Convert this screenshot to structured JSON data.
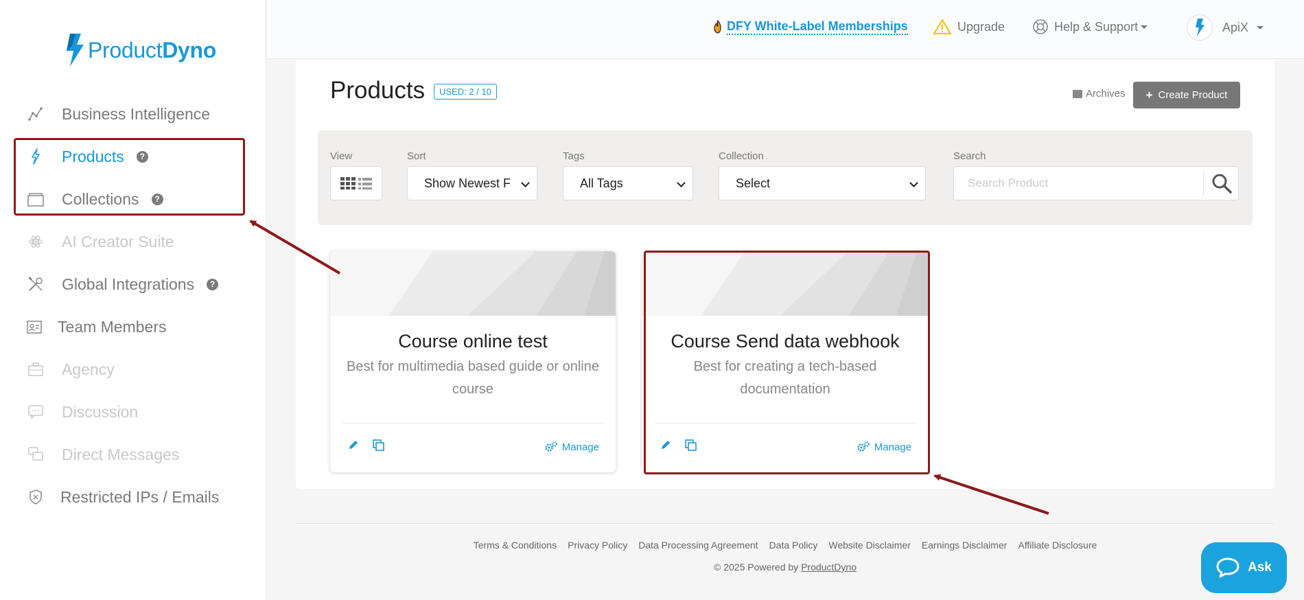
{
  "brand": {
    "name_light": "Product",
    "name_bold": "Dyno",
    "color": "#1a97d8"
  },
  "sidebar": {
    "items": [
      {
        "label": "Business Intelligence",
        "icon": "chart-line-icon"
      },
      {
        "label": "Products",
        "icon": "bolt-icon",
        "active": true
      },
      {
        "label": "Collections",
        "icon": "folder-icon"
      },
      {
        "label": "AI Creator Suite",
        "icon": "atom-icon",
        "disabled": true
      },
      {
        "label": "Global Integrations",
        "icon": "tools-icon"
      },
      {
        "label": "Team Members",
        "icon": "id-card-icon"
      },
      {
        "label": "Agency",
        "icon": "briefcase-icon",
        "disabled": true
      },
      {
        "label": "Discussion",
        "icon": "chat-icon",
        "disabled": true
      },
      {
        "label": "Direct Messages",
        "icon": "messages-icon",
        "disabled": true
      },
      {
        "label": "Restricted IPs / Emails",
        "icon": "shield-icon"
      }
    ]
  },
  "topbar": {
    "dfy_label": "DFY White-Label Memberships",
    "upgrade_label": "Upgrade",
    "help_label": "Help & Support",
    "user_name": "ApiX"
  },
  "main": {
    "title": "Products",
    "usage_badge": "USED: 2 / 10",
    "archives_label": "Archives",
    "create_label": "Create Product"
  },
  "filters": {
    "view_label": "View",
    "sort_label": "Sort",
    "sort_value": "Show Newest F",
    "tags_label": "Tags",
    "tags_value": "All Tags",
    "collection_label": "Collection",
    "collection_value": "Select",
    "search_label": "Search",
    "search_placeholder": "Search Product"
  },
  "cards": [
    {
      "title": "Course online test",
      "description": "Best for multimedia based guide or online course",
      "manage_label": "Manage"
    },
    {
      "title": "Course Send data webhook",
      "description": "Best for creating a tech-based documentation",
      "manage_label": "Manage"
    }
  ],
  "footer": {
    "links": [
      "Terms & Conditions",
      "Privacy Policy",
      "Data Processing Agreement",
      "Data Policy",
      "Website Disclaimer",
      "Earnings Disclaimer",
      "Affiliate Disclosure"
    ],
    "copyright_prefix": "© 2025 Powered by ",
    "copyright_link": "ProductDyno"
  },
  "chat": {
    "label": "Ask"
  },
  "colors": {
    "accent": "#1a97d8",
    "highlight": "#8b1a1a",
    "chat": "#1aa3dd"
  }
}
